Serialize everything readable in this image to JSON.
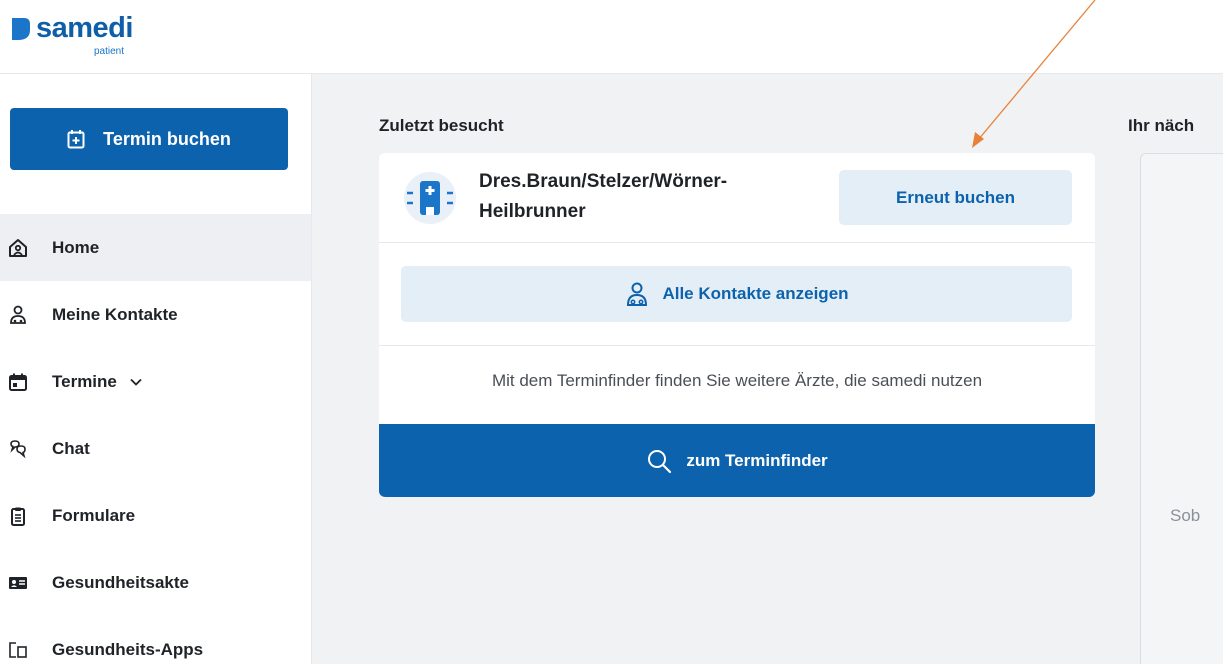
{
  "app": {
    "logo_word": "samedi",
    "logo_sub": "patient"
  },
  "sidebar": {
    "book_button": "Termin buchen",
    "items": [
      {
        "label": "Home",
        "icon": "home-icon"
      },
      {
        "label": "Meine Kontakte",
        "icon": "contacts-icon"
      },
      {
        "label": "Termine",
        "icon": "calendar-icon"
      },
      {
        "label": "Chat",
        "icon": "chat-icon"
      },
      {
        "label": "Formulare",
        "icon": "clipboard-icon"
      },
      {
        "label": "Gesundheitsakte",
        "icon": "health-record-icon"
      },
      {
        "label": "Gesundheits-Apps",
        "icon": "apps-icon"
      }
    ]
  },
  "main": {
    "recent_title": "Zuletzt besucht",
    "clinic_name": "Dres.Braun/Stelzer/Wörner-Heilbrunner",
    "rebook_button": "Erneut buchen",
    "contacts_button": "Alle Kontakte anzeigen",
    "finder_text": "Mit dem Terminfinder finden Sie weitere Ärzte, die samedi nutzen",
    "finder_button": "zum Terminfinder",
    "next_title": "Ihr näch",
    "next_partial_text": "Sob"
  },
  "colors": {
    "brand_blue": "#0d62ad",
    "light_blue": "#e4eef6",
    "annotation_arrow": "#e8823a"
  }
}
